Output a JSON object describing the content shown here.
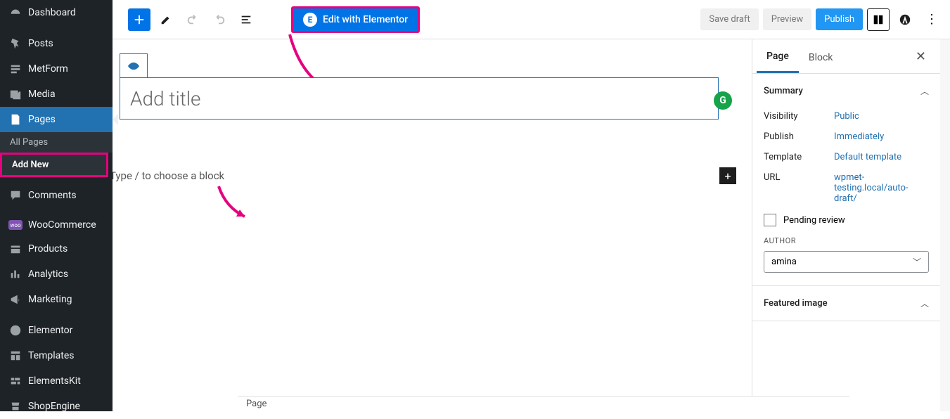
{
  "sidebar": {
    "items": [
      {
        "icon": "dashboard",
        "label": "Dashboard"
      },
      {
        "icon": "pin",
        "label": "Posts"
      },
      {
        "icon": "form",
        "label": "MetForm"
      },
      {
        "icon": "media",
        "label": "Media"
      },
      {
        "icon": "page",
        "label": "Pages",
        "active": true
      },
      {
        "icon": "comment",
        "label": "Comments"
      },
      {
        "icon": "woo",
        "label": "WooCommerce"
      },
      {
        "icon": "product",
        "label": "Products"
      },
      {
        "icon": "chart",
        "label": "Analytics"
      },
      {
        "icon": "megaphone",
        "label": "Marketing"
      },
      {
        "icon": "elementor",
        "label": "Elementor"
      },
      {
        "icon": "templates",
        "label": "Templates"
      },
      {
        "icon": "kit",
        "label": "ElementsKit"
      },
      {
        "icon": "shop",
        "label": "ShopEngine"
      }
    ],
    "sub": [
      "All Pages",
      "Add New"
    ]
  },
  "toolbar": {
    "elementor_label": "Edit with Elementor",
    "save_draft": "Save draft",
    "preview": "Preview",
    "publish": "Publish"
  },
  "editor": {
    "title_placeholder": "Add title",
    "block_prompt": "Type / to choose a block"
  },
  "settings": {
    "tabs": [
      "Page",
      "Block"
    ],
    "summary": {
      "title": "Summary",
      "visibility": {
        "label": "Visibility",
        "value": "Public"
      },
      "publish": {
        "label": "Publish",
        "value": "Immediately"
      },
      "template": {
        "label": "Template",
        "value": "Default template"
      },
      "url": {
        "label": "URL",
        "value": "wpmet-testing.local/auto-draft/"
      },
      "pending": "Pending review",
      "author_label": "AUTHOR",
      "author_value": "amina"
    },
    "featured": {
      "title": "Featured image"
    }
  },
  "footer": {
    "breadcrumb": "Page"
  }
}
